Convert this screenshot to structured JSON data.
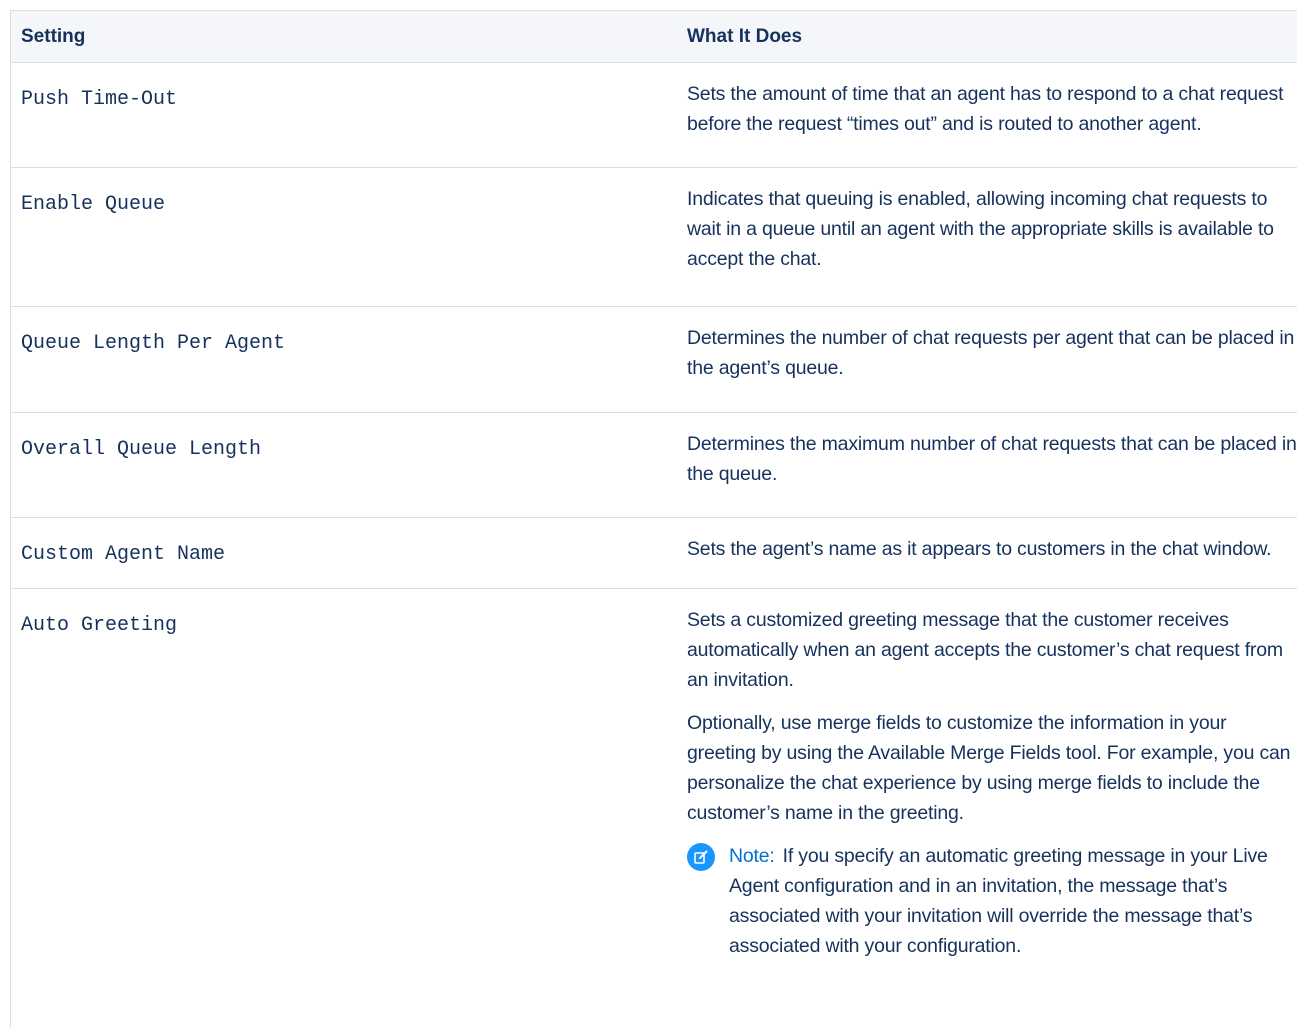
{
  "table": {
    "headers": {
      "setting": "Setting",
      "what_it_does": "What It Does"
    },
    "rows": [
      {
        "setting": "Push Time-Out",
        "paragraphs": [
          "Sets the amount of time that an agent has to respond to a chat request before the request “times out” and is routed to another agent."
        ]
      },
      {
        "setting": "Enable Queue",
        "paragraphs": [
          "Indicates that queuing is enabled, allowing incoming chat requests to wait in a queue until an agent with the appropriate skills is available to accept the chat."
        ]
      },
      {
        "setting": "Queue Length Per Agent",
        "paragraphs": [
          "Determines the number of chat requests per agent that can be placed in the agent’s queue."
        ]
      },
      {
        "setting": "Overall Queue Length",
        "paragraphs": [
          "Determines the maximum number of chat requests that can be placed in the queue."
        ]
      },
      {
        "setting": "Custom Agent Name",
        "paragraphs": [
          "Sets the agent’s name as it appears to customers in the chat window."
        ]
      },
      {
        "setting": "Auto Greeting",
        "paragraphs": [
          "Sets a customized greeting message that the customer receives automatically when an agent accepts the customer’s chat request from an invitation.",
          "Optionally, use merge fields to customize the information in your greeting by using the Available Merge Fields tool. For example, you can personalize the chat experience by using merge fields to include the customer’s name in the greeting."
        ],
        "note": {
          "label": "Note:",
          "text": "If you specify an automatic greeting message in your Live Agent configuration and in an invitation, the message that’s associated with your invitation will override the message that’s associated with your configuration.",
          "icon": "edit-note-icon",
          "icon_color": "#1b96ff",
          "label_color": "#0070d2"
        }
      }
    ]
  }
}
